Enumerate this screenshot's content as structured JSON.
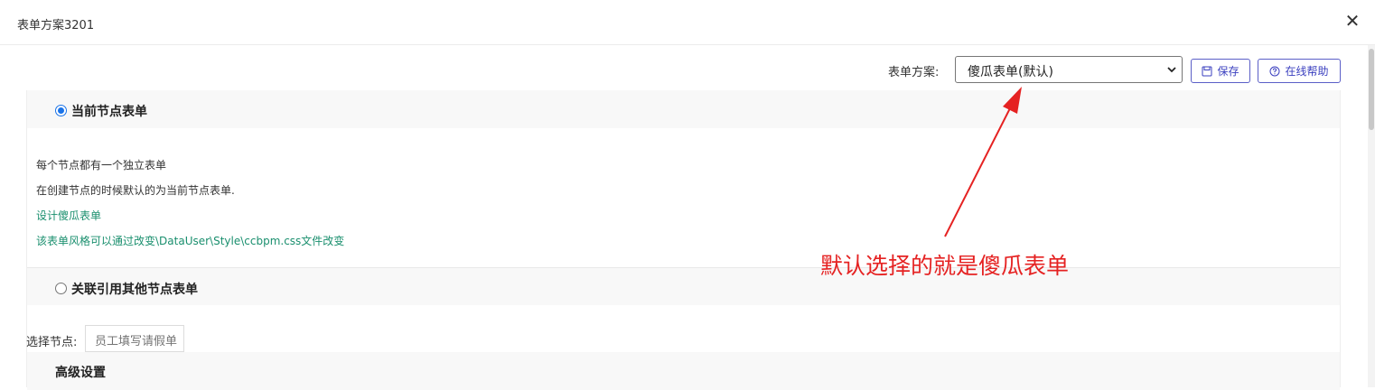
{
  "dialog": {
    "title": "表单方案3201",
    "close_icon": "close-icon"
  },
  "toolbar": {
    "scheme_label": "表单方案:",
    "scheme_value": "傻瓜表单(默认)",
    "save_label": "保存",
    "save_icon": "save-icon",
    "help_label": "在线帮助",
    "help_icon": "help-icon"
  },
  "sections": {
    "current_node": {
      "title": "当前节点表单",
      "selected": true,
      "desc_1": "每个节点都有一个独立表单",
      "desc_2": "在创建节点的时候默认的为当前节点表单.",
      "link_design": "设计傻瓜表单",
      "link_style": "该表单风格可以通过改变\\DataUser\\Style\\ccbpm.css文件改变"
    },
    "reference_node": {
      "title": "关联引用其他节点表单",
      "selected": false,
      "node_label": "选择节点:",
      "node_placeholder": "员工填写请假单"
    },
    "advanced": {
      "title": "高级设置"
    }
  },
  "annotation": {
    "text": "默认选择的就是傻瓜表单",
    "color": "#e52222"
  },
  "colors": {
    "accent": "#3a3fbf",
    "link": "#1a8f6e",
    "radio": "#1a73e8"
  }
}
